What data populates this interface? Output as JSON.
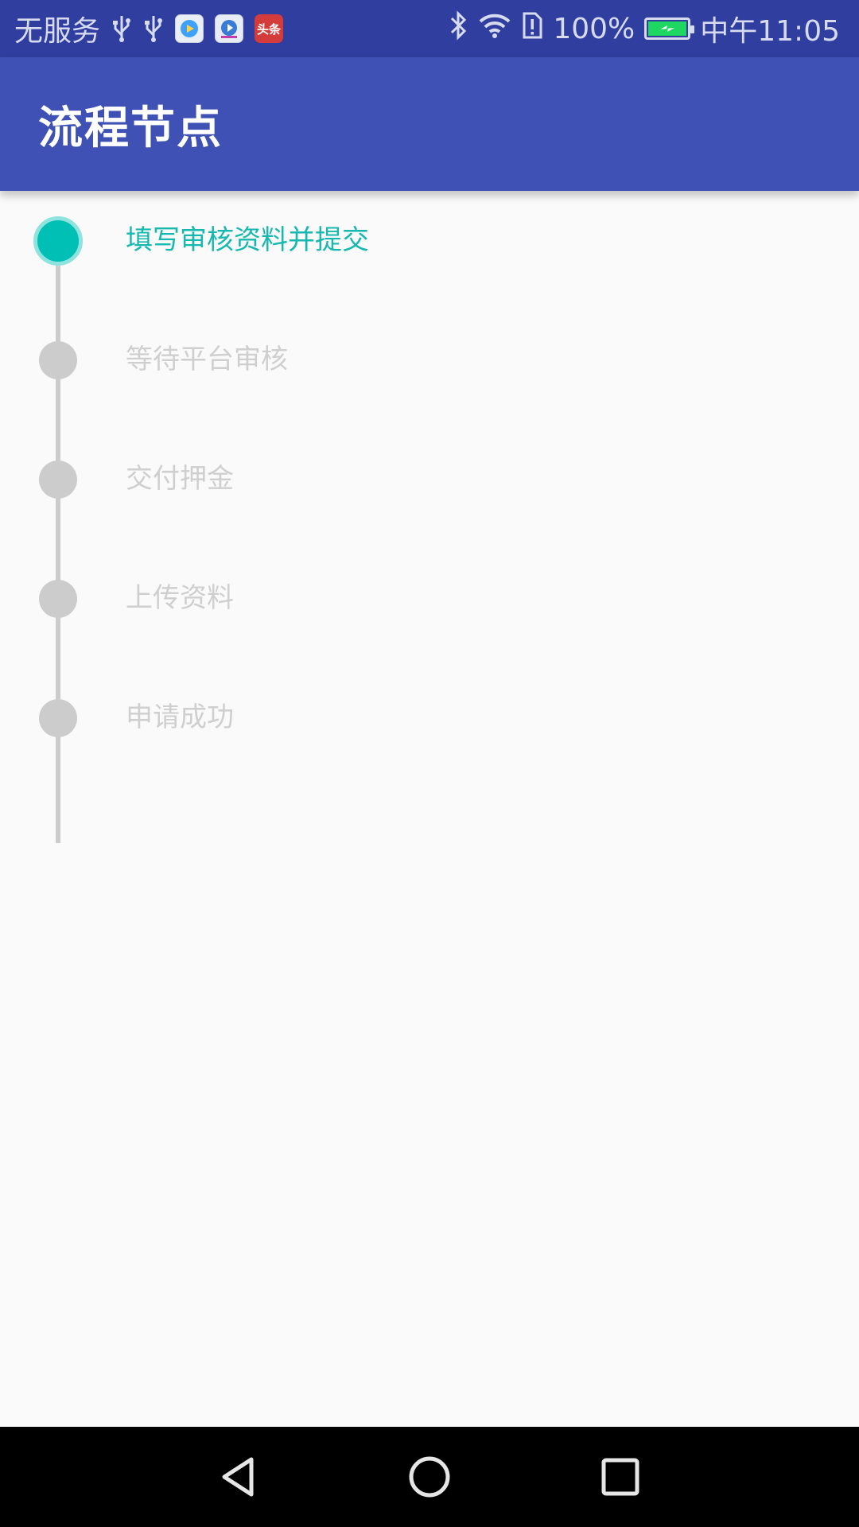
{
  "status_bar": {
    "carrier": "无服务",
    "battery_percent": "100%",
    "time": "中午11:05",
    "icons": [
      "usb-icon",
      "usb-icon",
      "video-app-icon",
      "tv-app-icon",
      "news-app-icon",
      "bluetooth-icon",
      "wifi-icon",
      "sim-alert-icon",
      "battery-charging-icon"
    ],
    "news_badge_text": "头条",
    "colors": {
      "background": "#303f9f",
      "battery_fill": "#1ed760"
    }
  },
  "app_bar": {
    "title": "流程节点",
    "background": "#3f51b5"
  },
  "timeline": {
    "active_color": "#00bfb5",
    "inactive_color": "#cccccc",
    "steps": [
      {
        "label": "填写审核资料并提交",
        "state": "active"
      },
      {
        "label": "等待平台审核",
        "state": "inactive"
      },
      {
        "label": "交付押金",
        "state": "inactive"
      },
      {
        "label": "上传资料",
        "state": "inactive"
      },
      {
        "label": "申请成功",
        "state": "inactive"
      }
    ]
  },
  "nav_bar": {
    "icons": [
      "back-icon",
      "home-icon",
      "recents-icon"
    ]
  }
}
